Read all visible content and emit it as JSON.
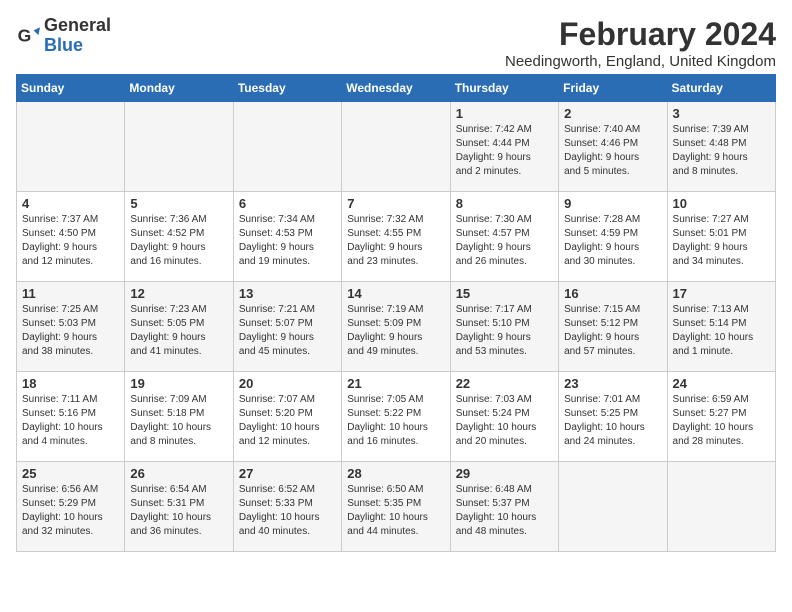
{
  "logo": {
    "line1": "General",
    "line2": "Blue"
  },
  "title": "February 2024",
  "location": "Needingworth, England, United Kingdom",
  "days_of_week": [
    "Sunday",
    "Monday",
    "Tuesday",
    "Wednesday",
    "Thursday",
    "Friday",
    "Saturday"
  ],
  "weeks": [
    [
      {
        "day": "",
        "info": ""
      },
      {
        "day": "",
        "info": ""
      },
      {
        "day": "",
        "info": ""
      },
      {
        "day": "",
        "info": ""
      },
      {
        "day": "1",
        "info": "Sunrise: 7:42 AM\nSunset: 4:44 PM\nDaylight: 9 hours\nand 2 minutes."
      },
      {
        "day": "2",
        "info": "Sunrise: 7:40 AM\nSunset: 4:46 PM\nDaylight: 9 hours\nand 5 minutes."
      },
      {
        "day": "3",
        "info": "Sunrise: 7:39 AM\nSunset: 4:48 PM\nDaylight: 9 hours\nand 8 minutes."
      }
    ],
    [
      {
        "day": "4",
        "info": "Sunrise: 7:37 AM\nSunset: 4:50 PM\nDaylight: 9 hours\nand 12 minutes."
      },
      {
        "day": "5",
        "info": "Sunrise: 7:36 AM\nSunset: 4:52 PM\nDaylight: 9 hours\nand 16 minutes."
      },
      {
        "day": "6",
        "info": "Sunrise: 7:34 AM\nSunset: 4:53 PM\nDaylight: 9 hours\nand 19 minutes."
      },
      {
        "day": "7",
        "info": "Sunrise: 7:32 AM\nSunset: 4:55 PM\nDaylight: 9 hours\nand 23 minutes."
      },
      {
        "day": "8",
        "info": "Sunrise: 7:30 AM\nSunset: 4:57 PM\nDaylight: 9 hours\nand 26 minutes."
      },
      {
        "day": "9",
        "info": "Sunrise: 7:28 AM\nSunset: 4:59 PM\nDaylight: 9 hours\nand 30 minutes."
      },
      {
        "day": "10",
        "info": "Sunrise: 7:27 AM\nSunset: 5:01 PM\nDaylight: 9 hours\nand 34 minutes."
      }
    ],
    [
      {
        "day": "11",
        "info": "Sunrise: 7:25 AM\nSunset: 5:03 PM\nDaylight: 9 hours\nand 38 minutes."
      },
      {
        "day": "12",
        "info": "Sunrise: 7:23 AM\nSunset: 5:05 PM\nDaylight: 9 hours\nand 41 minutes."
      },
      {
        "day": "13",
        "info": "Sunrise: 7:21 AM\nSunset: 5:07 PM\nDaylight: 9 hours\nand 45 minutes."
      },
      {
        "day": "14",
        "info": "Sunrise: 7:19 AM\nSunset: 5:09 PM\nDaylight: 9 hours\nand 49 minutes."
      },
      {
        "day": "15",
        "info": "Sunrise: 7:17 AM\nSunset: 5:10 PM\nDaylight: 9 hours\nand 53 minutes."
      },
      {
        "day": "16",
        "info": "Sunrise: 7:15 AM\nSunset: 5:12 PM\nDaylight: 9 hours\nand 57 minutes."
      },
      {
        "day": "17",
        "info": "Sunrise: 7:13 AM\nSunset: 5:14 PM\nDaylight: 10 hours\nand 1 minute."
      }
    ],
    [
      {
        "day": "18",
        "info": "Sunrise: 7:11 AM\nSunset: 5:16 PM\nDaylight: 10 hours\nand 4 minutes."
      },
      {
        "day": "19",
        "info": "Sunrise: 7:09 AM\nSunset: 5:18 PM\nDaylight: 10 hours\nand 8 minutes."
      },
      {
        "day": "20",
        "info": "Sunrise: 7:07 AM\nSunset: 5:20 PM\nDaylight: 10 hours\nand 12 minutes."
      },
      {
        "day": "21",
        "info": "Sunrise: 7:05 AM\nSunset: 5:22 PM\nDaylight: 10 hours\nand 16 minutes."
      },
      {
        "day": "22",
        "info": "Sunrise: 7:03 AM\nSunset: 5:24 PM\nDaylight: 10 hours\nand 20 minutes."
      },
      {
        "day": "23",
        "info": "Sunrise: 7:01 AM\nSunset: 5:25 PM\nDaylight: 10 hours\nand 24 minutes."
      },
      {
        "day": "24",
        "info": "Sunrise: 6:59 AM\nSunset: 5:27 PM\nDaylight: 10 hours\nand 28 minutes."
      }
    ],
    [
      {
        "day": "25",
        "info": "Sunrise: 6:56 AM\nSunset: 5:29 PM\nDaylight: 10 hours\nand 32 minutes."
      },
      {
        "day": "26",
        "info": "Sunrise: 6:54 AM\nSunset: 5:31 PM\nDaylight: 10 hours\nand 36 minutes."
      },
      {
        "day": "27",
        "info": "Sunrise: 6:52 AM\nSunset: 5:33 PM\nDaylight: 10 hours\nand 40 minutes."
      },
      {
        "day": "28",
        "info": "Sunrise: 6:50 AM\nSunset: 5:35 PM\nDaylight: 10 hours\nand 44 minutes."
      },
      {
        "day": "29",
        "info": "Sunrise: 6:48 AM\nSunset: 5:37 PM\nDaylight: 10 hours\nand 48 minutes."
      },
      {
        "day": "",
        "info": ""
      },
      {
        "day": "",
        "info": ""
      }
    ]
  ]
}
